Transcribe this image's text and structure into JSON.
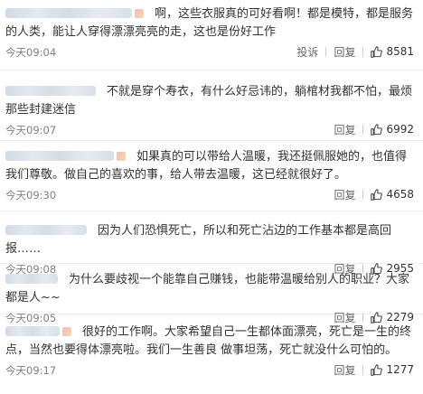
{
  "comments": [
    {
      "text": "啊，这些衣服真的可好看啊！都是模特，都是服务的人类，能让人穿得漂漂亮亮的走，这也是份好工作",
      "time": "今天09:04",
      "report": "投诉",
      "reply": "回复",
      "likes": "8581"
    },
    {
      "text": "不就是穿个寿衣，有什么好忌讳的，躺棺材我都不怕，最烦那些封建迷信",
      "time": "今天09:07",
      "reply": "回复",
      "likes": "6992"
    },
    {
      "text": "如果真的可以带给人温暖，我还挺佩服她的，也值得我们尊敬。做自己的喜欢的事，给人带去温暖，这已经就很好了。",
      "time": "今天09:30",
      "reply": "回复",
      "likes": "4658"
    },
    {
      "text": "因为人们恐惧死亡，所以和死亡沾边的工作基本都是高回报……",
      "time": "今天09:08",
      "reply": "回复",
      "likes": "2955"
    },
    {
      "text": "为什么要歧视一个能靠自己赚钱，也能带温暖给别人的职业？大家都是人~~",
      "time": "今天09:05",
      "reply": "回复",
      "likes": "2279"
    },
    {
      "text": "很好的工作啊。大家希望自己一生都体面漂亮，死亡是一生的终点，当然也要得体漂亮啦。我们一生善良 做事坦荡，死亡就没什么可怕的。",
      "time": "今天09:17",
      "reply": "回复",
      "likes": "1277"
    }
  ],
  "icons": {
    "like": "thumbs-up-icon"
  },
  "colors": {
    "text": "#333333",
    "meta": "#808080",
    "divider": "#eeeeee"
  }
}
